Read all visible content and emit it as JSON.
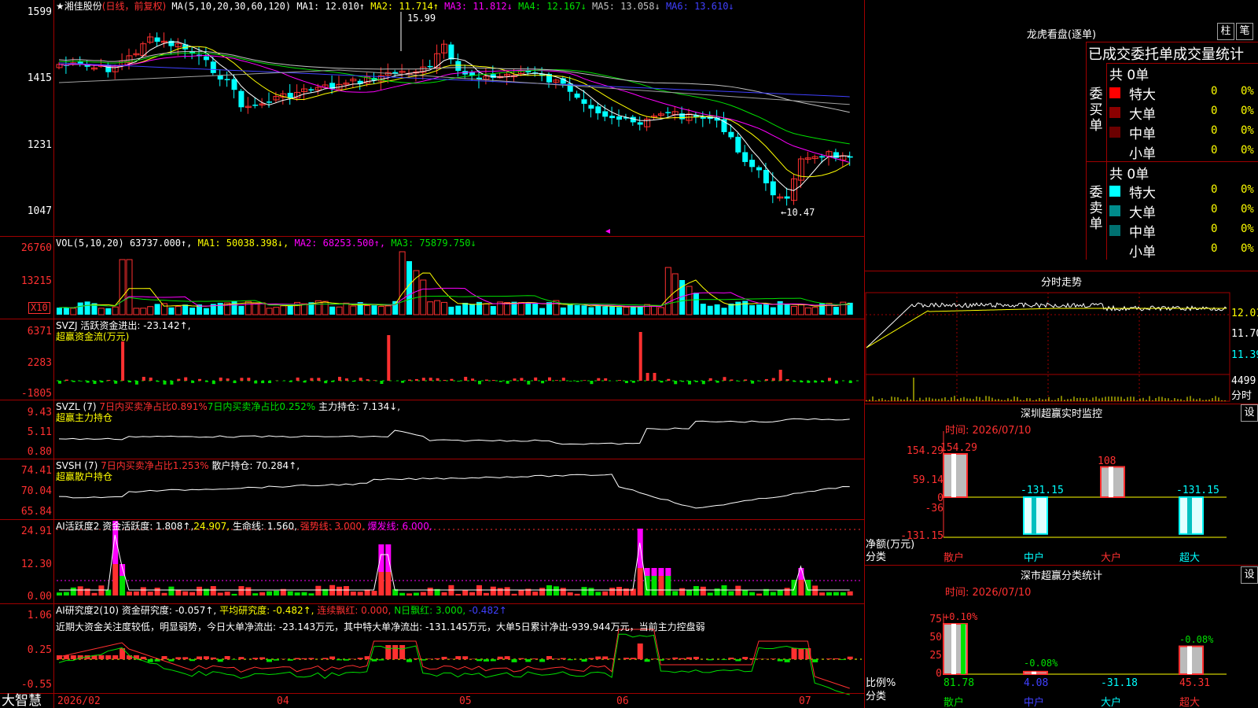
{
  "main": {
    "stock_title": "★湘佳股份",
    "period": "(日线，前复权)",
    "ma_prefix": "MA(5,10,20,30,60,120)",
    "ma": [
      {
        "label": "MA1:",
        "value": "12.010↑",
        "color": "#ffffff"
      },
      {
        "label": "MA2:",
        "value": "11.714↑",
        "color": "#ffff00"
      },
      {
        "label": "MA3:",
        "value": "11.812↓",
        "color": "#ff00ff"
      },
      {
        "label": "MA4:",
        "value": "12.167↓",
        "color": "#00e000"
      },
      {
        "label": "MA5:",
        "value": "13.058↓",
        "color": "#c0c0c0"
      },
      {
        "label": "MA6:",
        "value": "13.610↓",
        "color": "#4040ff"
      }
    ],
    "y_ticks": [
      "1599",
      "1415",
      "1231",
      "1047"
    ],
    "high_label": "15.99",
    "low_label": "←10.47"
  },
  "vol": {
    "header_prefix": "VOL(5,10,20)",
    "value": "63737.000↑,",
    "ma1": "MA1: 50038.398↓,",
    "ma2": "MA2: 68253.500↑,",
    "ma3": "MA3: 75879.750↓",
    "y_ticks": [
      "26760",
      "13215"
    ],
    "unit": "X10"
  },
  "svzj": {
    "line1": "SVZJ  活跃资金进出: -23.142↑,",
    "line2": "超赢资金流(万元)",
    "y_ticks": [
      "6371",
      "2283",
      "-1805"
    ]
  },
  "svzl": {
    "prefix": "SVZL (7)",
    "a": "7日内买卖净占比0.891%",
    "b": "7日内买卖净占比0.252%",
    "c": "主力持仓: 7.134↓,",
    "line2": "超赢主力持仓",
    "y_ticks": [
      "9.43",
      "5.11",
      "0.80"
    ]
  },
  "svsh": {
    "prefix": "SVSH (7)",
    "a": "7日内买卖净占比1.253%",
    "c": "散户持仓: 70.284↑,",
    "line2": "超赢散户持仓",
    "y_ticks": [
      "74.41",
      "70.04",
      "65.84"
    ]
  },
  "ai1": {
    "prefix": "AI活跃度2 资金活跃度: 1.808↑,",
    "b": "24.907,",
    "c": "生命线: 1.560,",
    "d": "强势线: 3.000,",
    "e": "爆发线: 6.000,",
    "y_ticks": [
      "24.91",
      "12.30",
      "0.00"
    ]
  },
  "ai2": {
    "prefix": "AI研究度2(10) 资金研究度: -0.057↑,",
    "b": "平均研究度: -0.482↑,",
    "c": "连续飘红: 0.000,",
    "d": "N日飘红: 3.000,",
    "e": "-0.482↑",
    "note": "近期大资金关注度较低，明显弱势，今日大单净流出: -23.143万元，其中特大单净流出: -131.145万元，大单5日累计净出-939.944万元，当前主力控盘弱",
    "y_ticks": [
      "1.06",
      "0.25",
      "-0.55"
    ]
  },
  "xaxis": {
    "brand": "大智慧",
    "labels": [
      "2026/02",
      "04",
      "05",
      "06",
      "07"
    ]
  },
  "dragon": {
    "title": "龙虎看盘(逐单)",
    "btn1": "柱",
    "btn2": "笔",
    "tabs": "已成交委托单成交量统计",
    "buy_side": "委买单",
    "sell_side": "委卖单",
    "buy_total": "共 0单",
    "sell_total": "共 0单",
    "buy_rows": [
      {
        "name": "特大",
        "value": "0",
        "pct": "0%",
        "color": "#ff0000"
      },
      {
        "name": "大单",
        "value": "0",
        "pct": "0%",
        "color": "#8b0000"
      },
      {
        "name": "中单",
        "value": "0",
        "pct": "0%",
        "color": "#6b0000"
      },
      {
        "name": "小单",
        "value": "0",
        "pct": "0%",
        "color": ""
      }
    ],
    "sell_rows": [
      {
        "name": "特大",
        "value": "0",
        "pct": "0%",
        "color": "#00ffff"
      },
      {
        "name": "大单",
        "value": "0",
        "pct": "0%",
        "color": "#008b8b"
      },
      {
        "name": "中单",
        "value": "0",
        "pct": "0%",
        "color": "#007070"
      },
      {
        "name": "小单",
        "value": "0",
        "pct": "0%",
        "color": ""
      }
    ]
  },
  "intraday": {
    "title": "分时走势",
    "y_ticks": [
      "12.01",
      "11.70",
      "11.39"
    ],
    "vol_tick": "4499",
    "vol_label": "分时"
  },
  "sz_monitor": {
    "title": "深圳超赢实时监控",
    "btn": "设",
    "time": "时间: 2026/07/10",
    "y_ticks": [
      "154.29",
      "59.14",
      "0",
      "-36",
      "-131.15"
    ],
    "unit": "净额(万元)",
    "cat_label": "分类",
    "bars": [
      {
        "cat": "散户",
        "value": 154.29,
        "label": "154.29"
      },
      {
        "cat": "中户",
        "value": -131.15,
        "label": "-131.15"
      },
      {
        "cat": "大户",
        "value": 108,
        "label": "108"
      },
      {
        "cat": "超大",
        "value": -131.15,
        "label": "-131.15"
      }
    ]
  },
  "sz_stats": {
    "title": "深市超赢分类统计",
    "btn": "设",
    "time": "时间: 2026/07/10",
    "y_ticks": [
      "75",
      "50",
      "25",
      "0"
    ],
    "unit": "比例%",
    "cat_label": "分类",
    "bars": [
      {
        "cat": "散户",
        "value": 81.78,
        "top": "+0.10%",
        "bottom": "81.78"
      },
      {
        "cat": "中户",
        "value": 4.08,
        "top": "-0.08%",
        "bottom": "4.08"
      },
      {
        "cat": "大户",
        "value": 0,
        "top": "",
        "bottom": "-31.18"
      },
      {
        "cat": "超大",
        "value": 45.31,
        "top": "-0.08%",
        "bottom": "45.31"
      }
    ]
  }
}
